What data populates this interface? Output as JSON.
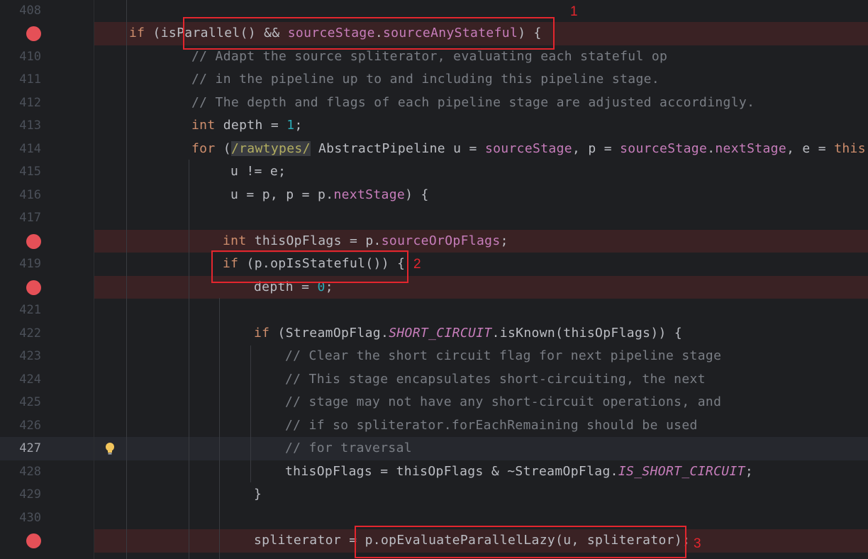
{
  "editor": {
    "lines": [
      {
        "num": "408",
        "bp": false,
        "current": false,
        "bulb": false,
        "indent": 0,
        "tokens": []
      },
      {
        "num": "",
        "bp": true,
        "current": false,
        "bulb": false,
        "indent": 0,
        "tokens": [
          {
            "t": "if",
            "c": "kw"
          },
          {
            "t": " (isParallel() && "
          },
          {
            "t": "sourceStage",
            "c": "fld"
          },
          {
            "t": "."
          },
          {
            "t": "sourceAnyStateful",
            "c": "fld"
          },
          {
            "t": ") {"
          }
        ]
      },
      {
        "num": "410",
        "bp": false,
        "current": false,
        "bulb": false,
        "indent": 4,
        "tokens": [
          {
            "t": "// Adapt the source spliterator, evaluating each stateful op",
            "c": "cmt"
          }
        ]
      },
      {
        "num": "411",
        "bp": false,
        "current": false,
        "bulb": false,
        "indent": 4,
        "tokens": [
          {
            "t": "// in the pipeline up to and including this pipeline stage.",
            "c": "cmt"
          }
        ]
      },
      {
        "num": "412",
        "bp": false,
        "current": false,
        "bulb": false,
        "indent": 4,
        "tokens": [
          {
            "t": "// The depth and flags of each pipeline stage are adjusted accordingly.",
            "c": "cmt"
          }
        ]
      },
      {
        "num": "413",
        "bp": false,
        "current": false,
        "bulb": false,
        "indent": 4,
        "tokens": [
          {
            "t": "int",
            "c": "kw"
          },
          {
            "t": " depth = "
          },
          {
            "t": "1",
            "c": "num"
          },
          {
            "t": ";"
          }
        ]
      },
      {
        "num": "414",
        "bp": false,
        "current": false,
        "bulb": false,
        "indent": 4,
        "tokens": [
          {
            "t": "for",
            "c": "kw"
          },
          {
            "t": " ("
          },
          {
            "t": "/rawtypes/",
            "c": "ann"
          },
          {
            "t": " AbstractPipeline u = "
          },
          {
            "t": "sourceStage",
            "c": "fld"
          },
          {
            "t": ", p = "
          },
          {
            "t": "sourceStage",
            "c": "fld"
          },
          {
            "t": "."
          },
          {
            "t": "nextStage",
            "c": "fld"
          },
          {
            "t": ", e = "
          },
          {
            "t": "this",
            "c": "kw"
          },
          {
            "t": ";"
          }
        ]
      },
      {
        "num": "415",
        "bp": false,
        "current": false,
        "bulb": false,
        "indent": 9,
        "tokens": [
          {
            "t": "u != e;"
          }
        ]
      },
      {
        "num": "416",
        "bp": false,
        "current": false,
        "bulb": false,
        "indent": 9,
        "tokens": [
          {
            "t": "u = p, p = p."
          },
          {
            "t": "nextStage",
            "c": "fld"
          },
          {
            "t": ") {"
          }
        ]
      },
      {
        "num": "417",
        "bp": false,
        "current": false,
        "bulb": false,
        "indent": 0,
        "tokens": []
      },
      {
        "num": "",
        "bp": true,
        "current": false,
        "bulb": false,
        "indent": 8,
        "tokens": [
          {
            "t": "int",
            "c": "kw"
          },
          {
            "t": " thisOpFlags = p."
          },
          {
            "t": "sourceOrOpFlags",
            "c": "fld"
          },
          {
            "t": ";"
          }
        ]
      },
      {
        "num": "419",
        "bp": false,
        "current": false,
        "bulb": false,
        "indent": 8,
        "tokens": [
          {
            "t": "if",
            "c": "kw"
          },
          {
            "t": " (p.opIsStateful()) {"
          }
        ]
      },
      {
        "num": "",
        "bp": true,
        "current": false,
        "bulb": false,
        "indent": 12,
        "tokens": [
          {
            "t": "depth = "
          },
          {
            "t": "0",
            "c": "num"
          },
          {
            "t": ";"
          }
        ]
      },
      {
        "num": "421",
        "bp": false,
        "current": false,
        "bulb": false,
        "indent": 0,
        "tokens": []
      },
      {
        "num": "422",
        "bp": false,
        "current": false,
        "bulb": false,
        "indent": 12,
        "tokens": [
          {
            "t": "if",
            "c": "kw"
          },
          {
            "t": " (StreamOpFlag."
          },
          {
            "t": "SHORT_CIRCUIT",
            "c": "itfld"
          },
          {
            "t": ".isKnown(thisOpFlags)) {"
          }
        ]
      },
      {
        "num": "423",
        "bp": false,
        "current": false,
        "bulb": false,
        "indent": 16,
        "tokens": [
          {
            "t": "// Clear the short circuit flag for next pipeline stage",
            "c": "cmt"
          }
        ]
      },
      {
        "num": "424",
        "bp": false,
        "current": false,
        "bulb": false,
        "indent": 16,
        "tokens": [
          {
            "t": "// This stage encapsulates short-circuiting, the next",
            "c": "cmt"
          }
        ]
      },
      {
        "num": "425",
        "bp": false,
        "current": false,
        "bulb": false,
        "indent": 16,
        "tokens": [
          {
            "t": "// stage may not have any short-circuit operations, and",
            "c": "cmt"
          }
        ]
      },
      {
        "num": "426",
        "bp": false,
        "current": false,
        "bulb": false,
        "indent": 16,
        "tokens": [
          {
            "t": "// if so spliterator.forEachRemaining should be used",
            "c": "cmt"
          }
        ]
      },
      {
        "num": "427",
        "bp": false,
        "current": true,
        "bulb": true,
        "indent": 16,
        "tokens": [
          {
            "t": "// for traversal",
            "c": "cmt"
          }
        ]
      },
      {
        "num": "428",
        "bp": false,
        "current": false,
        "bulb": false,
        "indent": 16,
        "tokens": [
          {
            "t": "thisOpFlags = thisOpFlags & ~StreamOpFlag."
          },
          {
            "t": "IS_SHORT_CIRCUIT",
            "c": "itfld"
          },
          {
            "t": ";"
          }
        ]
      },
      {
        "num": "429",
        "bp": false,
        "current": false,
        "bulb": false,
        "indent": 12,
        "tokens": [
          {
            "t": "}"
          }
        ]
      },
      {
        "num": "430",
        "bp": false,
        "current": false,
        "bulb": false,
        "indent": 0,
        "tokens": []
      },
      {
        "num": "",
        "bp": true,
        "current": false,
        "bulb": false,
        "indent": 12,
        "tokens": [
          {
            "t": "spliterator = p.opEvaluateParallelLazy(u, spliterator);"
          }
        ]
      }
    ]
  },
  "highlights": [
    {
      "label": "1"
    },
    {
      "label": "2"
    },
    {
      "label": "3"
    }
  ],
  "colors": {
    "background": "#1e1f22",
    "breakpoint": "#e55057",
    "breakpoint_line": "#3a2224",
    "keyword": "#cf8e6d",
    "field": "#c77dbb",
    "number": "#2aacb8",
    "comment": "#7a7e85",
    "annotation_box": "#e3262e"
  }
}
